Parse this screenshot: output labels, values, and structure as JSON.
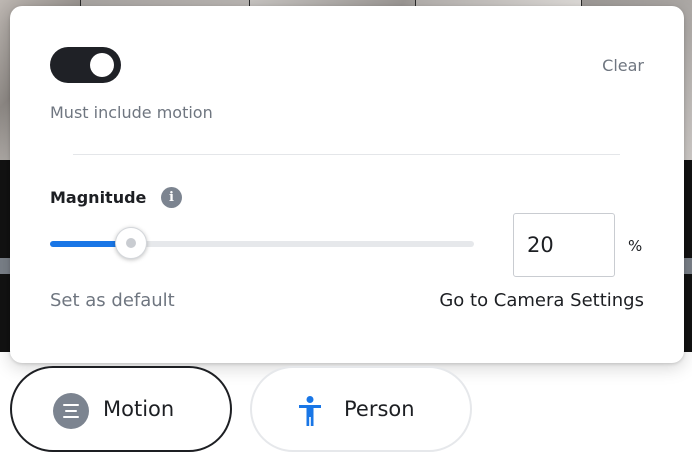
{
  "filter_panel": {
    "toggle_state": "on",
    "clear_label": "Clear",
    "motion_label": "Must include motion",
    "magnitude_label": "Magnitude",
    "info_icon": "info-icon",
    "slider_value_fraction": 0.19,
    "magnitude_value": "20",
    "percent_sign": "%",
    "set_default_label": "Set as default",
    "camera_settings_label": "Go to Camera Settings"
  },
  "chips": {
    "motion": {
      "label": "Motion",
      "icon": "motion-lines-icon",
      "selected": true
    },
    "person": {
      "label": "Person",
      "icon": "person-icon",
      "selected": false
    }
  },
  "colors": {
    "accent": "#1976e6",
    "toggle_on": "#1f2126",
    "muted_text": "#6f7680",
    "icon_gray": "#7c8490"
  }
}
